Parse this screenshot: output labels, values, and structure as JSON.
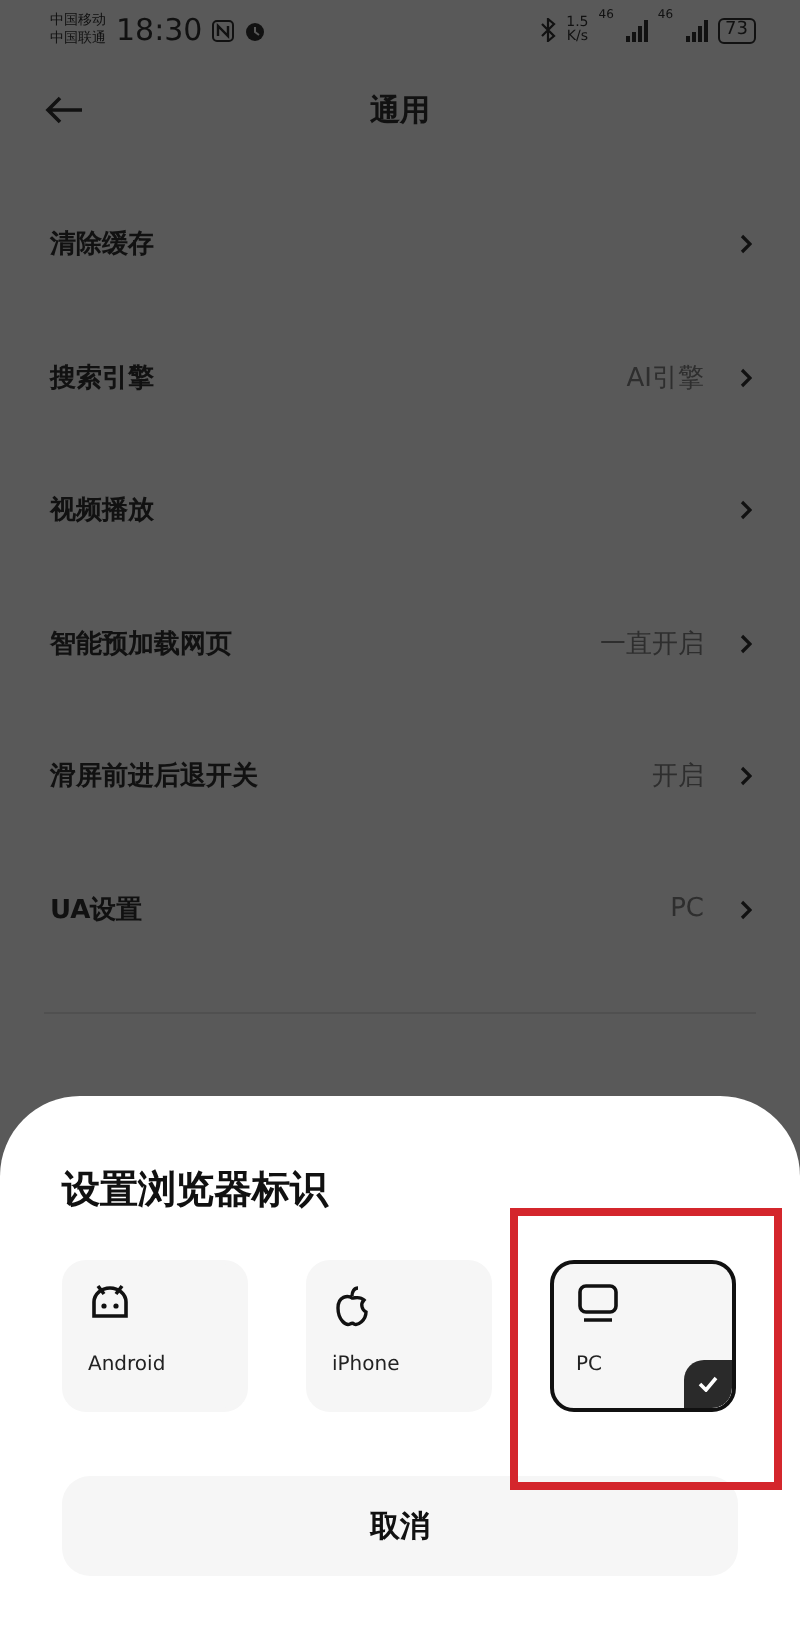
{
  "status_bar": {
    "carriers": [
      "中国移动",
      "中国联通"
    ],
    "time": "18:30",
    "speed": [
      "1.5",
      "K/s"
    ],
    "networks": [
      "46",
      "46"
    ],
    "battery": "73"
  },
  "header": {
    "title": "通用"
  },
  "settings": [
    {
      "label": "清除缓存"
    },
    {
      "label": "搜索引擎",
      "value": "AI引擎"
    },
    {
      "label": "视频播放"
    },
    {
      "label": "智能预加载网页",
      "value": "一直开启"
    },
    {
      "label": "滑屏前进后退开关",
      "value": "开启"
    },
    {
      "label": "UA设置",
      "value": "PC"
    }
  ],
  "sheet": {
    "title": "设置浏览器标识",
    "options": [
      {
        "kind": "android",
        "label": "Android",
        "selected": false
      },
      {
        "kind": "apple",
        "label": "iPhone",
        "selected": false
      },
      {
        "kind": "pc",
        "label": "PC",
        "selected": true
      }
    ],
    "cancel": "取消"
  }
}
